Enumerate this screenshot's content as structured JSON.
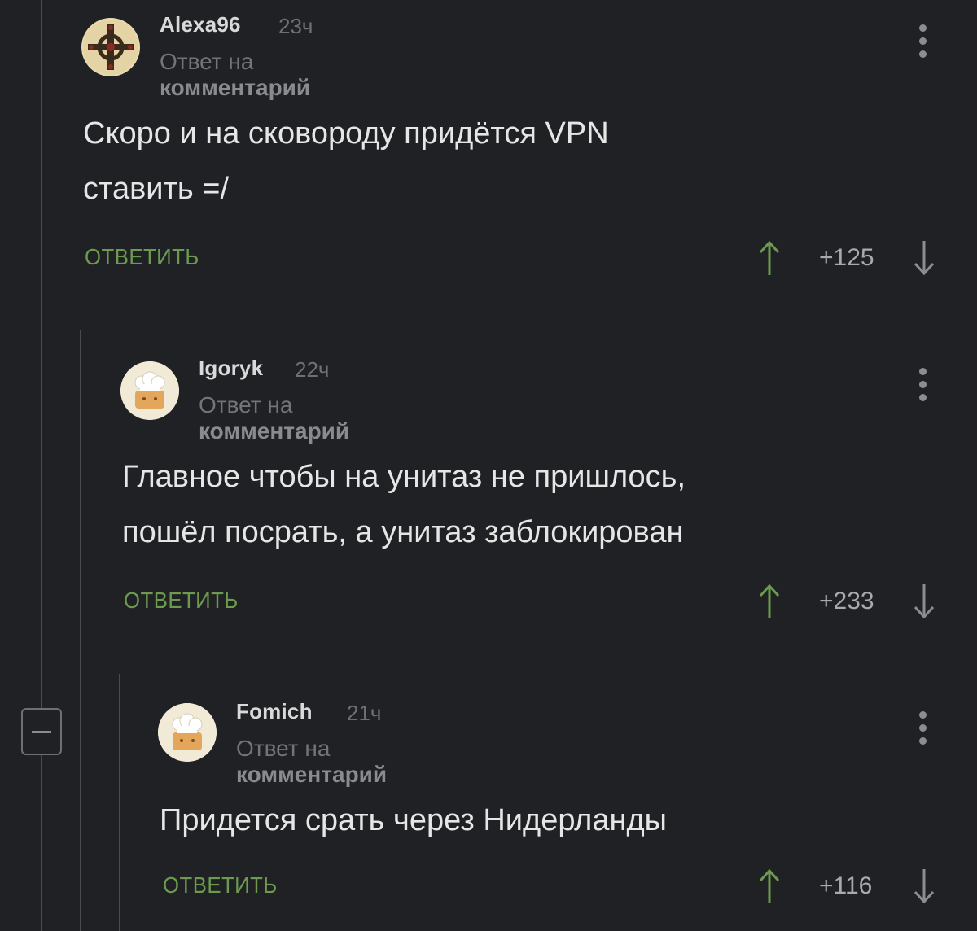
{
  "colors": {
    "background": "#202124",
    "reply_green": "#6c9a4f",
    "upvote_green": "#6c9a4f",
    "text": "#e6e6e6",
    "muted": "#737476"
  },
  "comments": [
    {
      "username": "Alexa96",
      "time": "23ч",
      "reply_prefix": "Ответ на ",
      "reply_link": "комментарий",
      "text_lines": [
        "Скоро и на сковороду придётся VPN",
        "ставить =/"
      ],
      "reply_label": "ОТВЕТИТЬ",
      "score": "+125",
      "avatar_icon": "celtic-cross-avatar-icon"
    },
    {
      "username": "Igoryk",
      "time": "22ч",
      "reply_prefix": "Ответ на ",
      "reply_link": "комментарий",
      "text_lines": [
        "Главное чтобы на унитаз не пришлось,",
        "пошёл посрать, а унитаз заблокирован"
      ],
      "reply_label": "ОТВЕТИТЬ",
      "score": "+233",
      "avatar_icon": "chef-avatar-icon"
    },
    {
      "username": "Fomich",
      "time": "21ч",
      "reply_prefix": "Ответ на ",
      "reply_link": "комментарий",
      "text_lines": [
        "Придется срать через Нидерланды"
      ],
      "reply_label": "ОТВЕТИТЬ",
      "score": "+116",
      "avatar_icon": "chef-avatar-icon"
    }
  ]
}
